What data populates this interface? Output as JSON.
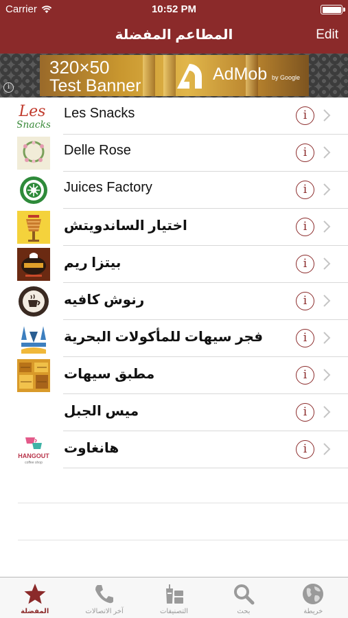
{
  "status_bar": {
    "carrier": "Carrier",
    "time": "10:52 PM"
  },
  "nav": {
    "title": "المطاعم المفضلة",
    "edit_label": "Edit"
  },
  "ad": {
    "size_text": "320×50",
    "test_text": "Test Banner",
    "brand": "AdMob",
    "by": "by Google",
    "info_glyph": "i"
  },
  "restaurants": [
    {
      "name": "Les Snacks",
      "logo": "les-snacks-logo",
      "logo_text": "Les",
      "logo_sub": "Snacks"
    },
    {
      "name": "Delle Rose",
      "logo": "delle-rose-logo"
    },
    {
      "name": "Juices Factory",
      "logo": "juices-factory-logo"
    },
    {
      "name": "اختيار الساندويتش",
      "logo": "sandwich-choice-logo"
    },
    {
      "name": "بيتزا ريم",
      "logo": "pizza-reem-logo"
    },
    {
      "name": "رنوش كافيه",
      "logo": "ranoush-cafe-logo"
    },
    {
      "name": "فجر سيهات للمأكولات البحرية",
      "logo": "fajr-seafood-logo"
    },
    {
      "name": "مطبق سيهات",
      "logo": "mutabbaq-saihat-logo"
    },
    {
      "name": "ميس الجبل",
      "logo": ""
    },
    {
      "name": "هانغاوت",
      "logo": "hangout-logo",
      "logo_text": "HANGOUT",
      "logo_sub": "coffee shop"
    }
  ],
  "row_info_glyph": "i",
  "tabs": [
    {
      "label": "المفضلة",
      "icon": "star-icon",
      "active": true
    },
    {
      "label": "آخر الاتصالات",
      "icon": "phone-icon",
      "active": false
    },
    {
      "label": "التصنيفات",
      "icon": "categories-icon",
      "active": false
    },
    {
      "label": "بحث",
      "icon": "search-icon",
      "active": false
    },
    {
      "label": "خريطة",
      "icon": "globe-icon",
      "active": false
    }
  ],
  "colors": {
    "brand": "#8b2a2a",
    "tab_inactive": "#9a9a9a"
  }
}
